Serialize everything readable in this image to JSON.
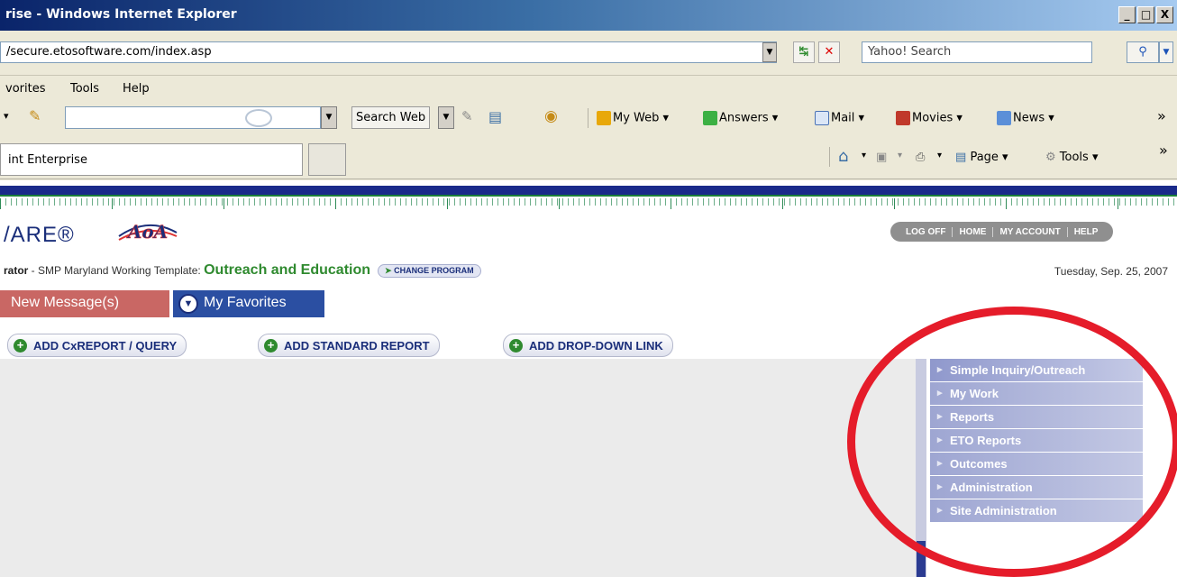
{
  "window": {
    "title": "rise - Windows Internet Explorer",
    "buttons": [
      "_",
      "□",
      "X"
    ]
  },
  "address": {
    "url": "/secure.etosoftware.com/index.asp",
    "search_placeholder": "Yahoo! Search"
  },
  "menubar": {
    "items": [
      "vorites",
      "Tools",
      "Help"
    ]
  },
  "toolbar": {
    "search_web": "Search Web",
    "my_web": "My Web",
    "answers": "Answers",
    "mail": "Mail",
    "movies": "Movies",
    "news": "News",
    "more": "»"
  },
  "tabbar": {
    "tab_label": "int Enterprise",
    "page": "Page",
    "tools": "Tools",
    "more": "»"
  },
  "header": {
    "logo": "/ARE®",
    "aoa_logo": "AoA",
    "nav": [
      "LOG OFF",
      "HOME",
      "MY ACCOUNT",
      "HELP"
    ],
    "role": "rator",
    "template_text": " - SMP Maryland Working Template: ",
    "program": "Outreach and Education",
    "change_program": "CHANGE PROGRAM",
    "date": "Tuesday, Sep. 25, 2007"
  },
  "tabs": {
    "messages": "New Message(s)",
    "favorites": "My Favorites"
  },
  "actions": {
    "add_cxreport": "ADD CxREPORT / QUERY",
    "add_standard": "ADD STANDARD REPORT",
    "add_dropdown": "ADD DROP-DOWN LINK"
  },
  "sidemenu": {
    "items": [
      "Simple Inquiry/Outreach",
      "My Work",
      "Reports",
      "ETO Reports",
      "Outcomes",
      "Administration",
      "Site Administration"
    ]
  },
  "colors": {
    "annotation_ellipse": "#e51c2a",
    "program_green": "#2f8a2f",
    "favorites_blue": "#2b4fa2",
    "messages_red": "#c96764"
  }
}
